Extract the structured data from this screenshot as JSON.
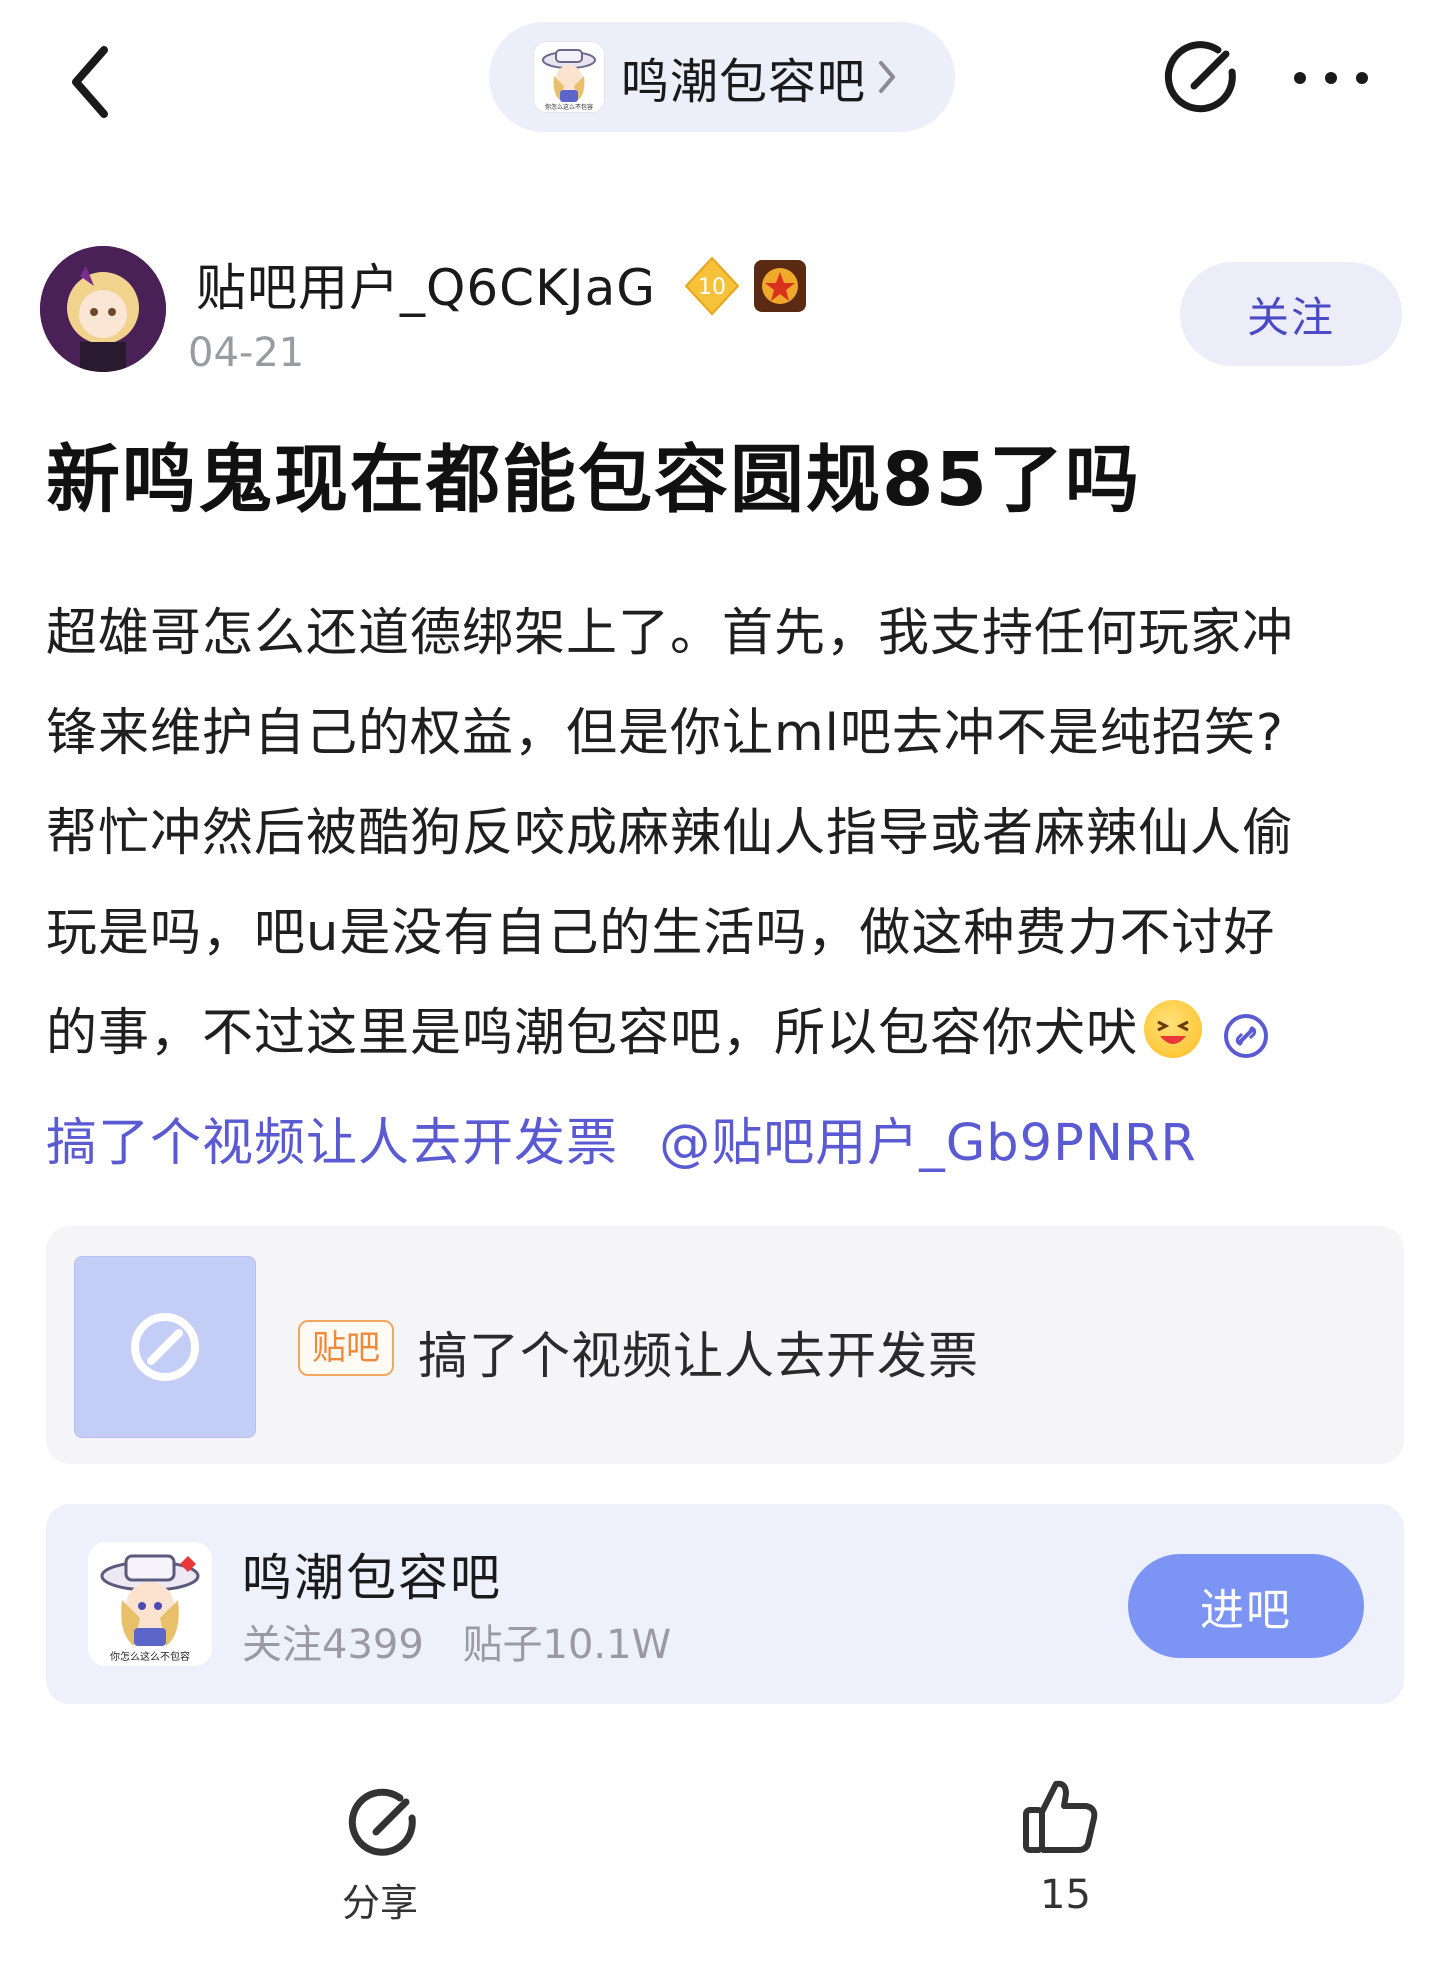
{
  "header": {
    "forum_name": "鸣潮包容吧",
    "forum_avatar_caption": "你怎么这么不包容"
  },
  "author": {
    "name": "贴吧用户_Q6CKJaG",
    "level": "10",
    "date": "04-21",
    "follow_label": "关注"
  },
  "post": {
    "title": "新鸣鬼现在都能包容圆规85了吗",
    "body_lines": [
      "超雄哥怎么还道德绑架上了。首先，我支持任何玩家冲",
      "锋来维护自己的权益，但是你让ml吧去冲不是纯招笑?",
      "帮忙冲然后被酷狗反咬成麻辣仙人指导或者麻辣仙人偷",
      "玩是吗，吧u是没有自己的生活吗，做这种费力不讨好",
      "的事，不过这里是鸣潮包容吧，所以包容你犬吠"
    ],
    "link_text": "搞了个视频让人去开发票",
    "mention": "@贴吧用户_Gb9PNRR"
  },
  "link_card": {
    "tag": "贴吧",
    "title": "搞了个视频让人去开发票"
  },
  "forum_card": {
    "name": "鸣潮包容吧",
    "followers": "关注4399",
    "posts": "贴子10.1W",
    "enter_label": "进吧",
    "avatar_caption": "你怎么这么不包容"
  },
  "actions": {
    "share_label": "分享",
    "like_count": "15"
  },
  "colors": {
    "accent_blue": "#5a5ad2",
    "enter_button": "#7c95f4",
    "pill_bg": "#eceef9"
  }
}
